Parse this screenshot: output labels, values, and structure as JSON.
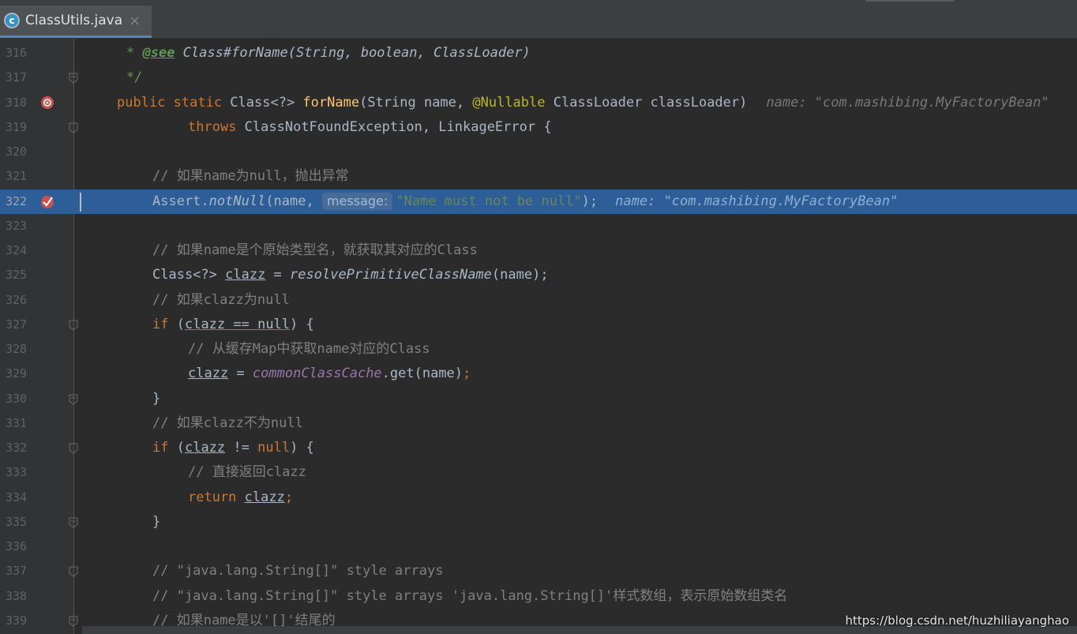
{
  "tab": {
    "title": "ClassUtils.java",
    "close": "×",
    "icon_letter": "c"
  },
  "colors": {
    "background": "#2b2b2b",
    "gutter": "#313335",
    "current_line": "#2d5e97",
    "keyword": "#cc7832",
    "comment": "#808080",
    "string": "#6a8759",
    "method": "#ffc66d",
    "annotation": "#bbb529",
    "field": "#9876aa"
  },
  "lines": [
    {
      "n": "316"
    },
    {
      "n": "317"
    },
    {
      "n": "318"
    },
    {
      "n": "319"
    },
    {
      "n": "320"
    },
    {
      "n": "321"
    },
    {
      "n": "322"
    },
    {
      "n": "323"
    },
    {
      "n": "324"
    },
    {
      "n": "325"
    },
    {
      "n": "326"
    },
    {
      "n": "327"
    },
    {
      "n": "328"
    },
    {
      "n": "329"
    },
    {
      "n": "330"
    },
    {
      "n": "331"
    },
    {
      "n": "332"
    },
    {
      "n": "333"
    },
    {
      "n": "334"
    },
    {
      "n": "335"
    },
    {
      "n": "336"
    },
    {
      "n": "337"
    },
    {
      "n": "338"
    },
    {
      "n": "339"
    }
  ],
  "code": {
    "l316": {
      "star": "* ",
      "tag": "@see",
      "ref": " Class#forName(String, boolean, ClassLoader)"
    },
    "l317": {
      "text": "*/"
    },
    "l318": {
      "kw": "public static ",
      "type": "Class<?> ",
      "fn": "forName",
      "p1": "(String name, ",
      "ann": "@Nullable",
      "p2": " ClassLoader classLoader)",
      "hint": "name: \"com.mashibing.MyFactoryBean\""
    },
    "l319": {
      "kw": "throws ",
      "rest": "ClassNotFoundException, LinkageError {"
    },
    "l321": {
      "text": "// 如果name为null，抛出异常"
    },
    "l322": {
      "a": "Assert.",
      "m": "notNull",
      "b": "(name, ",
      "param": "message:",
      "str": "\"Name must not be null\"",
      "c": ");",
      "hint": "name: \"com.mashibing.MyFactoryBean\""
    },
    "l324": {
      "text": "// 如果name是个原始类型名，就获取其对应的Class"
    },
    "l325": {
      "a": "Class<?> ",
      "v": "clazz",
      "b": " = ",
      "m": "resolvePrimitiveClassName",
      "c": "(name);"
    },
    "l326": {
      "text": "// 如果clazz为null"
    },
    "l327": {
      "kw": "if",
      "a": " (",
      "v": "clazz == null",
      "b": ") {"
    },
    "l328": {
      "text": "// 从缓存Map中获取name对应的Class"
    },
    "l329": {
      "v": "clazz",
      "a": " = ",
      "f": "commonClassCache",
      "b": ".get(name)",
      "c": ";"
    },
    "l330": {
      "text": "}"
    },
    "l331": {
      "text": "// 如果clazz不为null"
    },
    "l332": {
      "kw": "if",
      "a": " (",
      "v": "clazz",
      "b": " != ",
      "kw2": "null",
      "c": ") {"
    },
    "l333": {
      "text": "// 直接返回clazz"
    },
    "l334": {
      "kw": "return ",
      "v": "clazz",
      "c": ";"
    },
    "l335": {
      "text": "}"
    },
    "l337": {
      "text": "// \"java.lang.String[]\" style arrays"
    },
    "l338": {
      "text": "// \"java.lang.String[]\" style arrays 'java.lang.String[]'样式数组，表示原始数组类名"
    },
    "l339": {
      "text": "// 如果name是以'[]'结尾的"
    }
  },
  "watermark": "https://blog.csdn.net/huzhiliayanghao"
}
